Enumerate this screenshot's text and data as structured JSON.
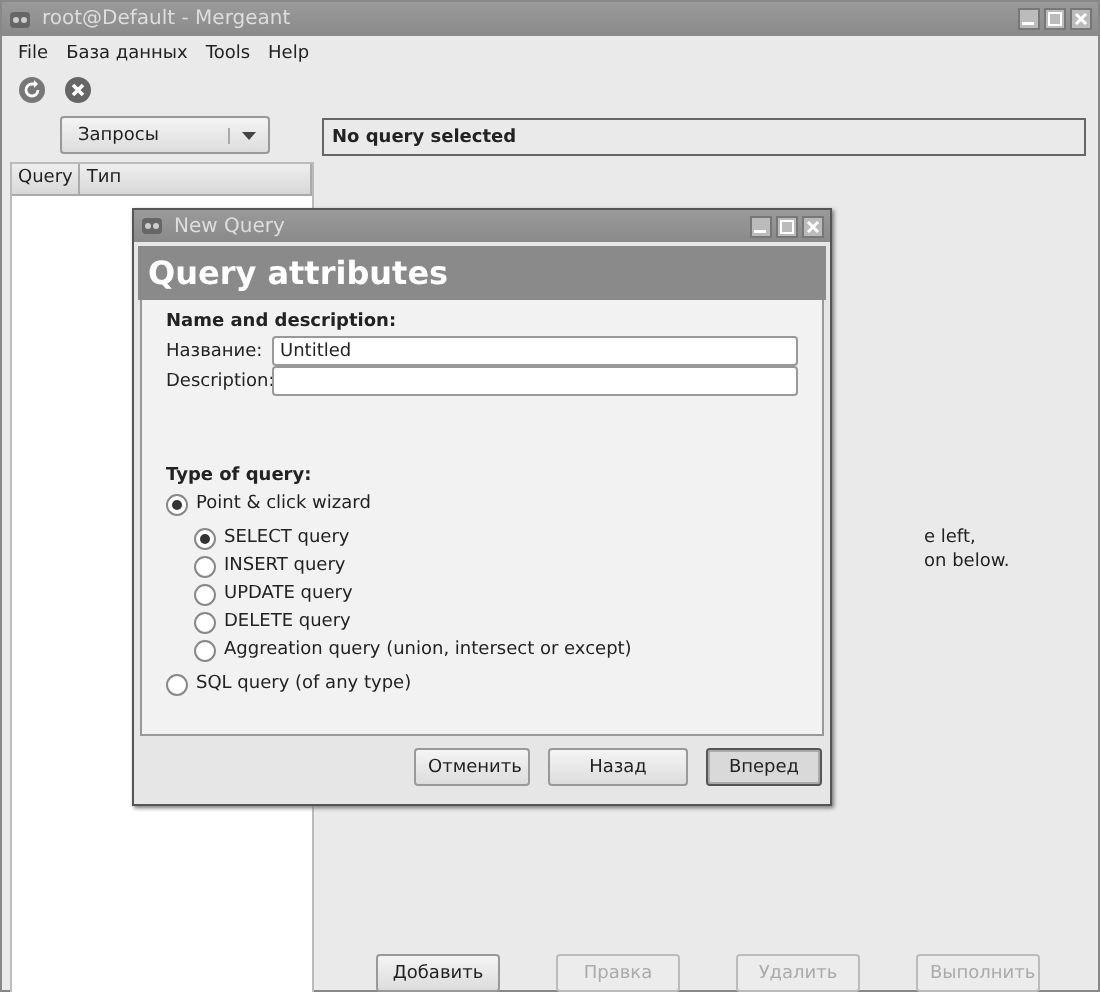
{
  "window": {
    "title": "root@Default - Mergeant"
  },
  "menu": [
    "File",
    "База данных",
    "Tools",
    "Help"
  ],
  "left_panel": {
    "selector": "Запросы",
    "columns": [
      "Query",
      "Тип"
    ]
  },
  "right_panel": {
    "header": "No query selected",
    "hint_lines": [
      "e left,",
      "on below."
    ],
    "buttons": [
      {
        "label": "Добавить",
        "disabled": false
      },
      {
        "label": "Правка",
        "disabled": true
      },
      {
        "label": "Удалить",
        "disabled": true
      },
      {
        "label": "Выполнить",
        "disabled": true
      }
    ]
  },
  "dialog": {
    "title": "New Query",
    "heading": "Query attributes",
    "section_name": "Name and description:",
    "fields": [
      {
        "label": "Название:",
        "value": "Untitled"
      },
      {
        "label": "Description:"
      }
    ],
    "section_type": "Type of query:",
    "options": [
      {
        "label": "Point & click wizard",
        "selected": true,
        "children": [
          {
            "label": "SELECT query",
            "selected": true
          },
          {
            "label": "INSERT query",
            "selected": false
          },
          {
            "label": "UPDATE query",
            "selected": false
          },
          {
            "label": "DELETE query",
            "selected": false
          },
          {
            "label": "Aggreation query (union, intersect or except)",
            "selected": false
          }
        ]
      },
      {
        "label": "SQL query (of any type)",
        "selected": false
      }
    ],
    "buttons": [
      {
        "label": "Отменить",
        "default": false
      },
      {
        "label": "Назад",
        "default": false
      },
      {
        "label": "Вперед",
        "default": true
      }
    ]
  }
}
